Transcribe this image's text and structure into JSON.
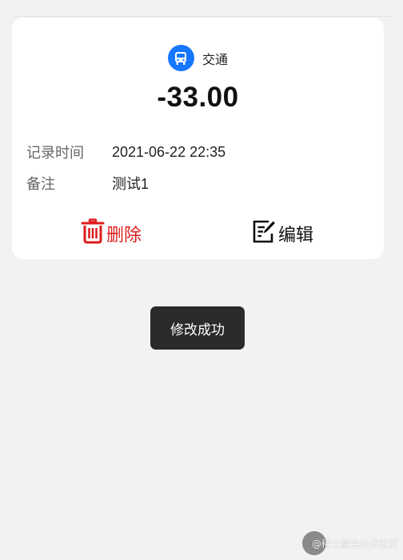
{
  "record": {
    "category": "交通",
    "category_icon": "bus-icon",
    "amount": "-33.00",
    "time_label": "记录时间",
    "time_value": "2021-06-22 22:35",
    "note_label": "备注",
    "note_value": "测试1"
  },
  "actions": {
    "delete_label": "删除",
    "delete_icon": "trash-icon",
    "edit_label": "编辑",
    "edit_icon": "edit-icon"
  },
  "toast": {
    "message": "修改成功"
  },
  "watermark": {
    "text": "@稀土掘金技术社区"
  },
  "colors": {
    "accent": "#1677ff",
    "danger": "#dd1c1c",
    "background": "#f2f2f2"
  }
}
